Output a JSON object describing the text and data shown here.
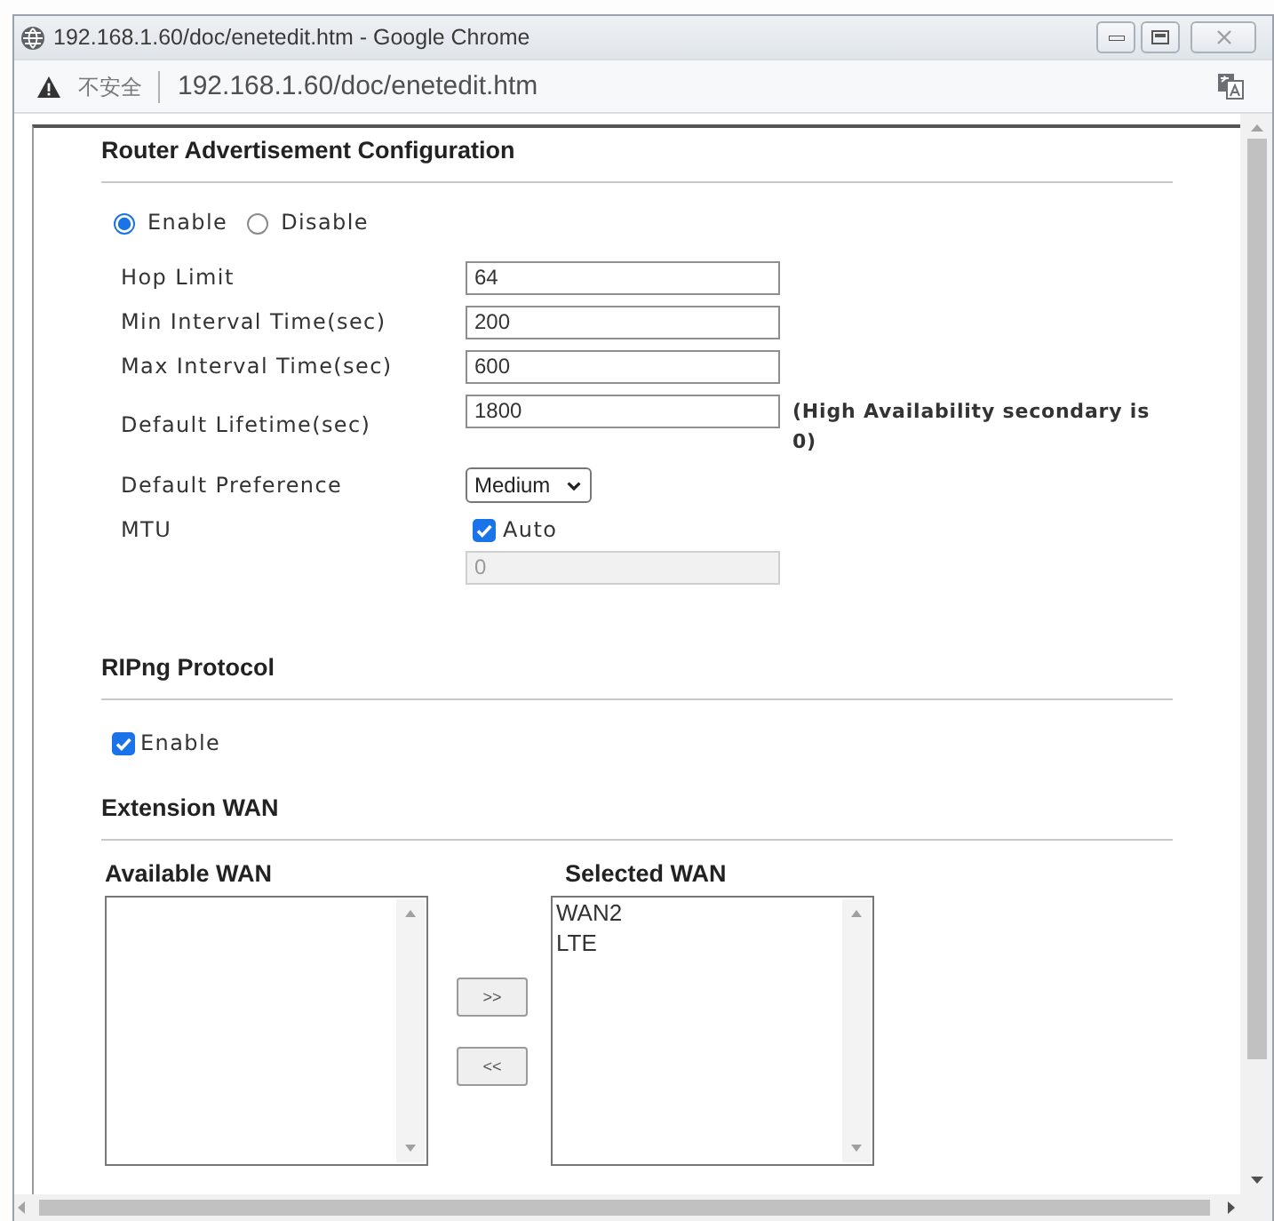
{
  "window": {
    "title": "192.168.1.60/doc/enetedit.htm - Google Chrome"
  },
  "address_bar": {
    "security_label": "不安全",
    "url": "192.168.1.60/doc/enetedit.htm"
  },
  "router_advertisement": {
    "title": "Router Advertisement Configuration",
    "options": [
      {
        "label": "Enable",
        "selected": true
      },
      {
        "label": "Disable",
        "selected": false
      }
    ],
    "fields": [
      {
        "kind": "text",
        "label": "Hop Limit",
        "value": "64"
      },
      {
        "kind": "text",
        "label": "Min Interval Time(sec)",
        "value": "200"
      },
      {
        "kind": "text",
        "label": "Max Interval Time(sec)",
        "value": "600"
      },
      {
        "kind": "text",
        "label": "Default Lifetime(sec)",
        "value": "1800",
        "note": "(High Availability secondary is 0)"
      },
      {
        "kind": "select",
        "label": "Default Preference",
        "value": "Medium"
      },
      {
        "kind": "checkbox",
        "label": "MTU",
        "option_label": "Auto",
        "checked": true,
        "value": "0",
        "disabled": true
      }
    ]
  },
  "ripng": {
    "title": "RIPng Protocol",
    "enable": {
      "label": "Enable",
      "checked": true
    }
  },
  "extension_wan": {
    "title": "Extension WAN",
    "available_wan": {
      "label": "Available WAN"
    },
    "buttons": [
      {
        "label": ">>"
      },
      {
        "label": "<<"
      }
    ],
    "selected_wan": {
      "label": "Selected WAN",
      "items": [
        {
          "label": "WAN2",
          "selected": false
        },
        {
          "label": "LTE",
          "selected": false
        }
      ]
    }
  }
}
